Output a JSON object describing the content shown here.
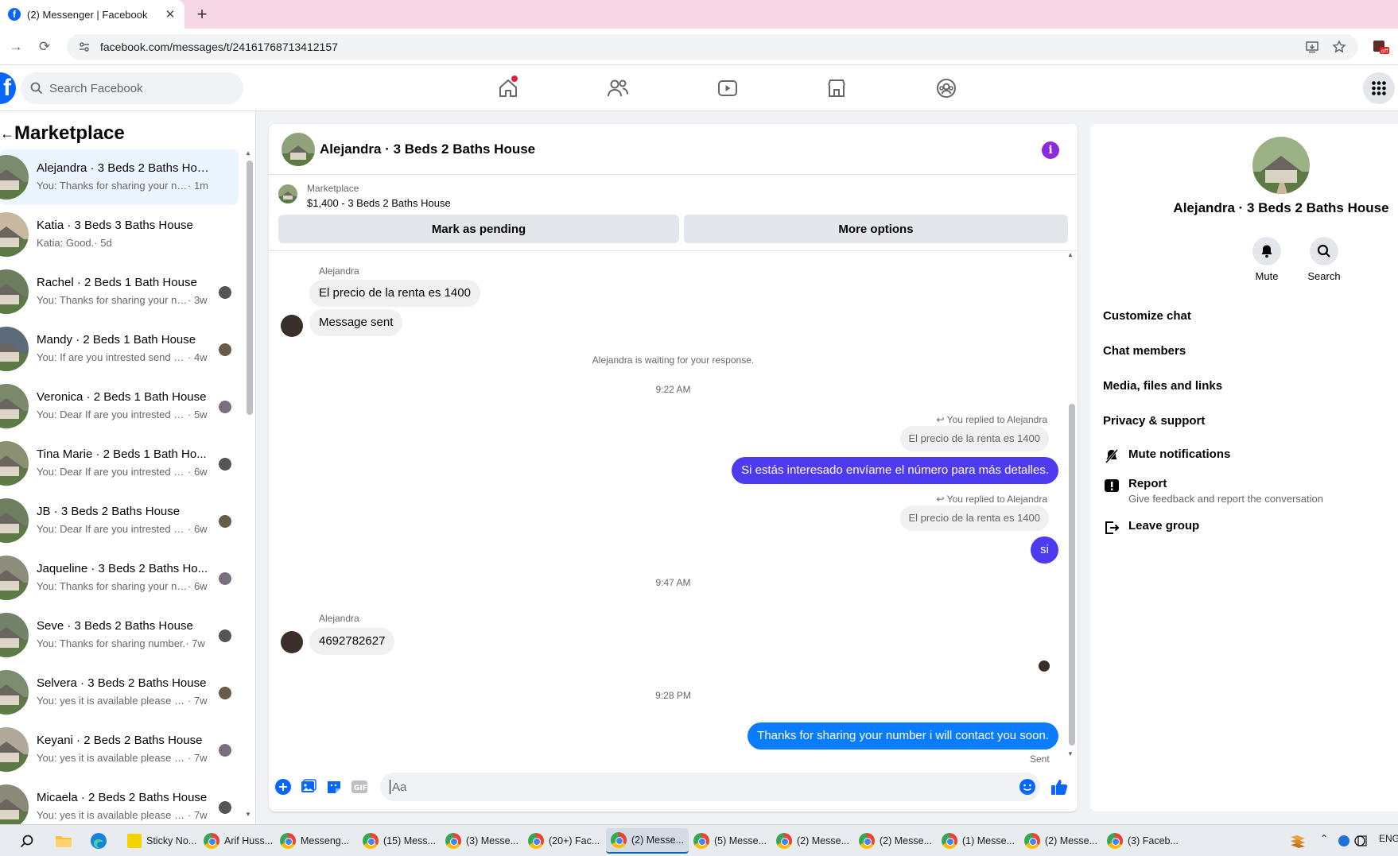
{
  "browser": {
    "tab_title": "(2) Messenger | Facebook",
    "url": "facebook.com/messages/t/24161768713412157"
  },
  "fb_nav": {
    "search_placeholder": "Search Facebook",
    "icons": [
      "home-icon",
      "friends-icon",
      "video-icon",
      "marketplace-icon",
      "groups-icon",
      "menu-grid-icon"
    ]
  },
  "sidebar": {
    "title": "Marketplace",
    "conversations": [
      {
        "title": "Alejandra · 3 Beds 2 Baths House",
        "snippet": "You: Thanks for sharing your numb...",
        "time": "· 1m",
        "active": true,
        "thumb": "#7b8c6e"
      },
      {
        "title": "Katia · 3 Beds 3 Baths House",
        "snippet": "Katia: Good.",
        "time": "· 5d",
        "active": false,
        "thumb": "#c9b8a0"
      },
      {
        "title": "Rachel · 2 Beds 1 Bath House",
        "snippet": "You: Thanks for sharing your nu...",
        "time": "· 3w",
        "active": false,
        "thumb": "#6b7d5c"
      },
      {
        "title": "Mandy · 2 Beds 1 Bath House",
        "snippet": "You: If are you intrested send m...",
        "time": "· 4w",
        "active": false,
        "thumb": "#5c6b7a"
      },
      {
        "title": "Veronica · 2 Beds 1 Bath House",
        "snippet": "You: Dear If are you intrested se...",
        "time": "· 5w",
        "active": false,
        "thumb": "#7a8a6a"
      },
      {
        "title": "Tina Marie · 2 Beds 1 Bath Ho...",
        "snippet": "You: Dear If are you intrested se...",
        "time": "· 6w",
        "active": false,
        "thumb": "#8a9070"
      },
      {
        "title": "JB · 3 Beds 2 Baths House",
        "snippet": "You: Dear If are you intrested se...",
        "time": "· 6w",
        "active": false,
        "thumb": "#6e7f60"
      },
      {
        "title": "Jaqueline · 3 Beds 2 Baths Ho...",
        "snippet": "You: Thanks for sharing your nu...",
        "time": "· 6w",
        "active": false,
        "thumb": "#8c8d7a"
      },
      {
        "title": "Seve · 3 Beds 2 Baths House",
        "snippet": "You: Thanks for sharing number.",
        "time": "· 7w",
        "active": false,
        "thumb": "#72836a"
      },
      {
        "title": "Selvera · 3 Beds 2 Baths House",
        "snippet": "You: yes it is available please se...",
        "time": "· 7w",
        "active": false,
        "thumb": "#7d8e70"
      },
      {
        "title": "Keyani · 2 Beds 2 Baths House",
        "snippet": "You: yes it is available please se...",
        "time": "· 7w",
        "active": false,
        "thumb": "#b0a898"
      },
      {
        "title": "Micaela · 2 Beds 2 Baths House",
        "snippet": "You: yes it is available please se...",
        "time": "· 7w",
        "active": false,
        "thumb": "#8b8a78"
      }
    ]
  },
  "chat": {
    "title": "Alejandra · 3 Beds 2 Baths House",
    "listing_source": "Marketplace",
    "listing_price": "$1,400 - 3 Beds 2 Baths House",
    "mark_pending_label": "Mark as pending",
    "more_options_label": "More options",
    "sender_name": "Alejandra",
    "msg1": "El precio de la renta es 1400",
    "msg2": "Message sent",
    "waiting_text": "Alejandra is waiting for your response.",
    "time1": "9:22 AM",
    "replied_label": "You replied to Alejandra",
    "quoted": "El precio de la renta es 1400",
    "out1": "Si estás interesado envíame el número para más detalles.",
    "out2": "si",
    "time2": "9:47 AM",
    "msg3": "4692782627",
    "time3": "9:28 PM",
    "out3": "Thanks for sharing your number i will contact you soon.",
    "sent_label": "Sent",
    "composer_placeholder": "Aa"
  },
  "info_panel": {
    "name": "Alejandra · 3 Beds 2 Baths House",
    "mute_label": "Mute",
    "search_label": "Search",
    "customize_chat": "Customize chat",
    "chat_members": "Chat members",
    "media_files": "Media, files and links",
    "privacy_support": "Privacy & support",
    "mute_notifications": "Mute notifications",
    "report": "Report",
    "report_sub": "Give feedback and report the conversation",
    "leave_group": "Leave group"
  },
  "taskbar": {
    "apps": [
      {
        "label": "Sticky No...",
        "type": "sticky"
      },
      {
        "label": "Arif Huss...",
        "type": "chrome"
      },
      {
        "label": "Messeng...",
        "type": "chrome"
      },
      {
        "label": "(15) Mess...",
        "type": "chrome"
      },
      {
        "label": "(3) Messe...",
        "type": "chrome"
      },
      {
        "label": "(20+) Fac...",
        "type": "chrome"
      },
      {
        "label": "(2) Messe...",
        "type": "chrome",
        "active": true
      },
      {
        "label": "(5) Messe...",
        "type": "chrome"
      },
      {
        "label": "(2) Messe...",
        "type": "chrome"
      },
      {
        "label": "(2) Messe...",
        "type": "chrome"
      },
      {
        "label": "(1) Messe...",
        "type": "chrome"
      },
      {
        "label": "(2) Messe...",
        "type": "chrome"
      },
      {
        "label": "(3) Faceb...",
        "type": "chrome"
      }
    ],
    "lang": "ENG"
  }
}
